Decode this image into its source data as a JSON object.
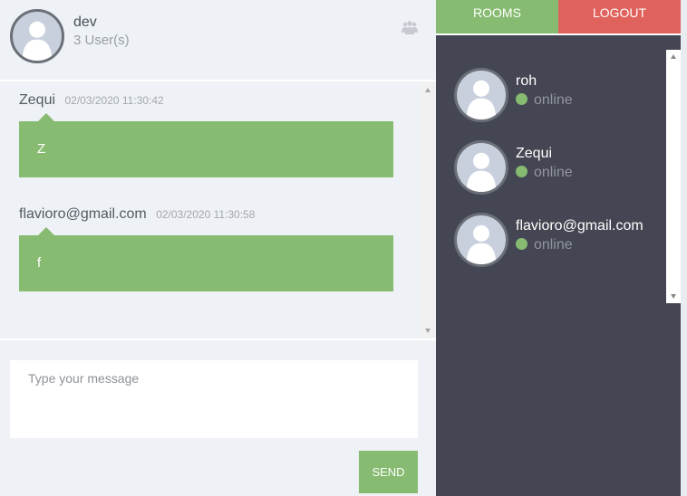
{
  "room": {
    "name": "dev",
    "users_count": "3 User(s)",
    "icon": "users-group-icon"
  },
  "messages": [
    {
      "author": "Zequi",
      "time": "02/03/2020 11:30:42",
      "text": "Z"
    },
    {
      "author": "flavioro@gmail.com",
      "time": "02/03/2020 11:30:58",
      "text": "f"
    }
  ],
  "compose": {
    "placeholder": "Type your message",
    "send_label": "SEND"
  },
  "tabs": {
    "rooms": "ROOMS",
    "logout": "LOGOUT"
  },
  "users": [
    {
      "name": "roh",
      "status": "online"
    },
    {
      "name": "Zequi",
      "status": "online"
    },
    {
      "name": "flavioro@gmail.com",
      "status": "online"
    }
  ],
  "colors": {
    "accent_green": "#86bb71",
    "logout_red": "#e0625c",
    "sidebar_bg": "#444753",
    "online_dot": "#86bb71"
  }
}
